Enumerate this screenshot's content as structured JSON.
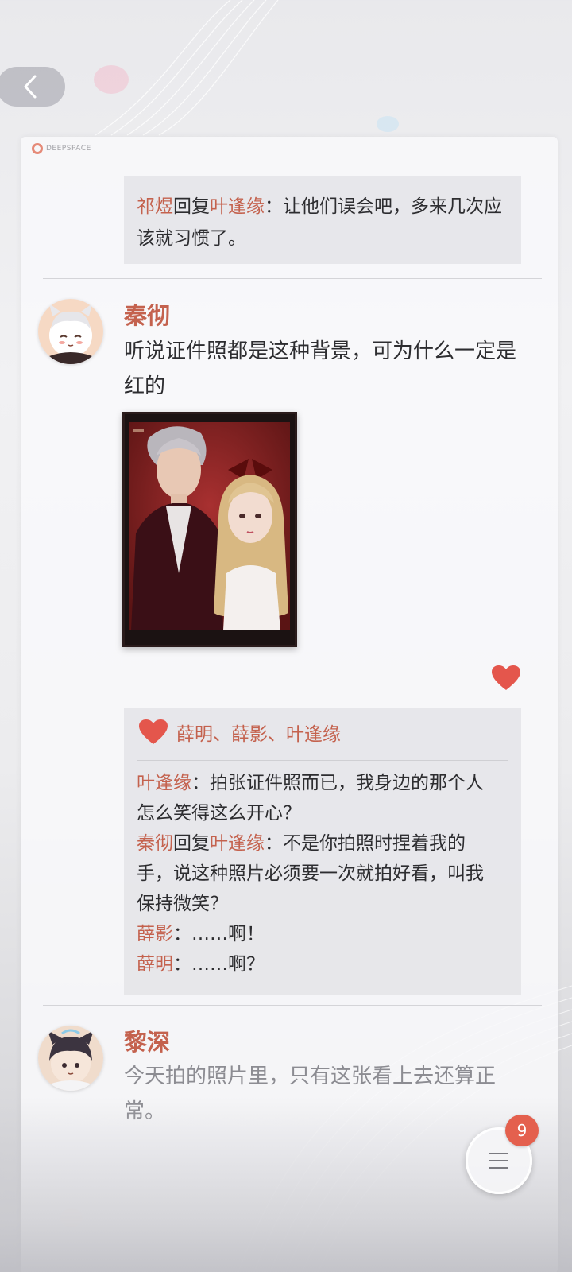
{
  "brand": {
    "label": "DEEPSPACE"
  },
  "top_reply": {
    "from": "祁煜",
    "joiner": "回复",
    "to": "叶逢缘",
    "sep": "：",
    "text": "让他们误会吧，多来几次应该就习惯了。"
  },
  "post1": {
    "author": "秦彻",
    "text": "听说证件照都是这种背景，可为什么一定是红的",
    "likes": "薛明、薛影、叶逢缘",
    "comments": [
      {
        "from": "叶逢缘",
        "joiner": "",
        "to": "",
        "sep": "：",
        "text": "拍张证件照而已，我身边的那个人怎么笑得这么开心？"
      },
      {
        "from": "秦彻",
        "joiner": "回复",
        "to": "叶逢缘",
        "sep": "：",
        "text": "不是你拍照时捏着我的手，说这种照片必须要一次就拍好看，叫我保持微笑？"
      },
      {
        "from": "薛影",
        "joiner": "",
        "to": "",
        "sep": "：",
        "text": "……啊！"
      },
      {
        "from": "薛明",
        "joiner": "",
        "to": "",
        "sep": "：",
        "text": "……啊？"
      }
    ]
  },
  "post2": {
    "author": "黎深",
    "text": "今天拍的照片里，只有这张看上去还算正常。"
  },
  "fab": {
    "badge": "9"
  },
  "colors": {
    "accent": "#c4624e",
    "heart": "#e4564c",
    "badge": "#e4604e"
  },
  "icons": {
    "back": "chevron-left-icon",
    "like": "heart-icon",
    "menu": "menu-icon"
  }
}
